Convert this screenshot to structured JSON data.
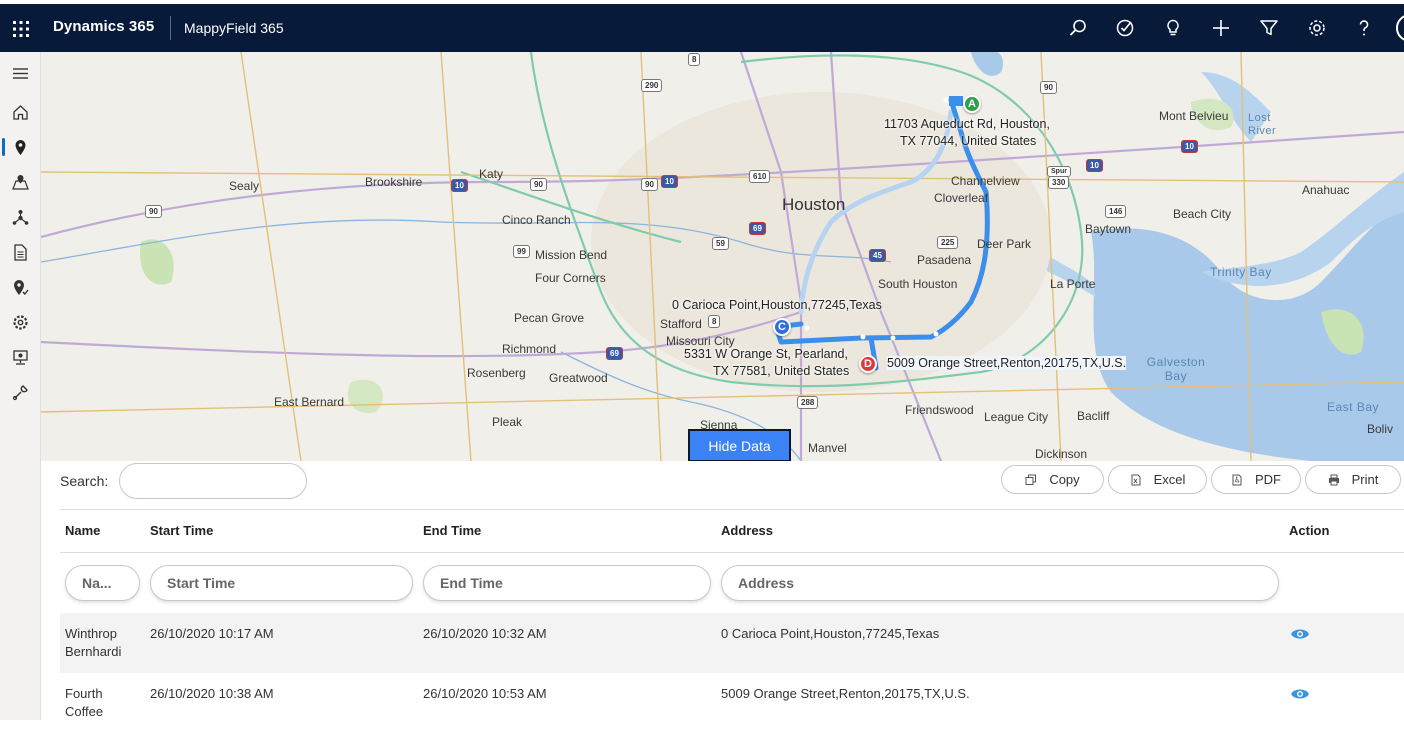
{
  "header": {
    "app_title": "Dynamics 365",
    "app_sub": "MappyField 365",
    "icons": [
      "search-icon",
      "task-icon",
      "lightbulb-icon",
      "plus-icon",
      "filter-icon",
      "gear-icon",
      "help-icon"
    ]
  },
  "sidebar": {
    "items": [
      "menu-icon",
      "home-icon",
      "map-pin-icon",
      "map-route-icon",
      "network-icon",
      "document-icon",
      "pin-check-icon",
      "gear-icon",
      "monitor-icon",
      "tools-icon"
    ],
    "active": "map-pin-icon"
  },
  "map": {
    "labels": {
      "houston": "Houston",
      "katy": "Katy",
      "sealy": "Sealy",
      "brookshire": "Brookshire",
      "cinco_ranch": "Cinco Ranch",
      "mission_bend": "Mission Bend",
      "four_corners": "Four Corners",
      "pecan_grove": "Pecan Grove",
      "richmond": "Richmond",
      "rosenberg": "Rosenberg",
      "greatwood": "Greatwood",
      "east_bernard": "East Bernard",
      "pleak": "Pleak",
      "sienna": "Sienna",
      "manvel": "Manvel",
      "stafford": "Stafford",
      "missouri_city": "Missouri City",
      "south_houston": "South Houston",
      "pasadena": "Pasadena",
      "deer_park": "Deer Park",
      "channelview": "Channelview",
      "cloverleaf": "Cloverleaf",
      "friendswood": "Friendswood",
      "league_city": "League City",
      "bacliff": "Bacliff",
      "dickinson": "Dickinson",
      "la_porte": "La Porte",
      "baytown": "Baytown",
      "beach_city": "Beach City",
      "anahuac": "Anahuac",
      "mont_belvieu": "Mont Belvieu",
      "lost_river": "Lost River",
      "trinity_bay": "Trinity Bay",
      "galveston_bay": "Galveston Bay",
      "east_bay": "East Bay",
      "boliv": "Boliv"
    },
    "highways": [
      "8",
      "290",
      "90",
      "10",
      "90",
      "90",
      "10",
      "610",
      "69",
      "59",
      "99",
      "8",
      "45",
      "225",
      "146",
      "330",
      "10",
      "10",
      "69",
      "288",
      "90",
      "Spur"
    ],
    "addresses": {
      "a_line1": "11703 Aqueduct Rd, Houston,",
      "a_line2": "TX 77044, United States",
      "c": "0 Carioca Point,Houston,77245,Texas",
      "b_line1": "5331 W Orange St, Pearland,",
      "b_line2": "TX 77581, United States",
      "d": "5009 Orange Street,Renton,20175,TX,U.S."
    },
    "pins": {
      "a": "A",
      "c": "C",
      "d": "D"
    },
    "route_color": "#3b8eea",
    "hide_data_label": "Hide Data"
  },
  "table": {
    "search_label": "Search:",
    "search_value": "",
    "buttons": {
      "copy": "Copy",
      "excel": "Excel",
      "pdf": "PDF",
      "print": "Print"
    },
    "columns": {
      "name": "Name",
      "start": "Start Time",
      "end": "End Time",
      "address": "Address",
      "action": "Action"
    },
    "filters": {
      "name": "Na...",
      "start": "Start Time",
      "end": "End Time",
      "address": "Address"
    },
    "rows": [
      {
        "name_1": "Winthrop",
        "name_2": "Bernhardi",
        "start": "26/10/2020 10:17 AM",
        "end": "26/10/2020 10:32 AM",
        "address": "0 Carioca Point,Houston,77245,Texas"
      },
      {
        "name_1": "Fourth",
        "name_2": "Coffee",
        "start": "26/10/2020 10:38 AM",
        "end": "26/10/2020 10:53 AM",
        "address": "5009 Orange Street,Renton,20175,TX,U.S."
      }
    ]
  }
}
